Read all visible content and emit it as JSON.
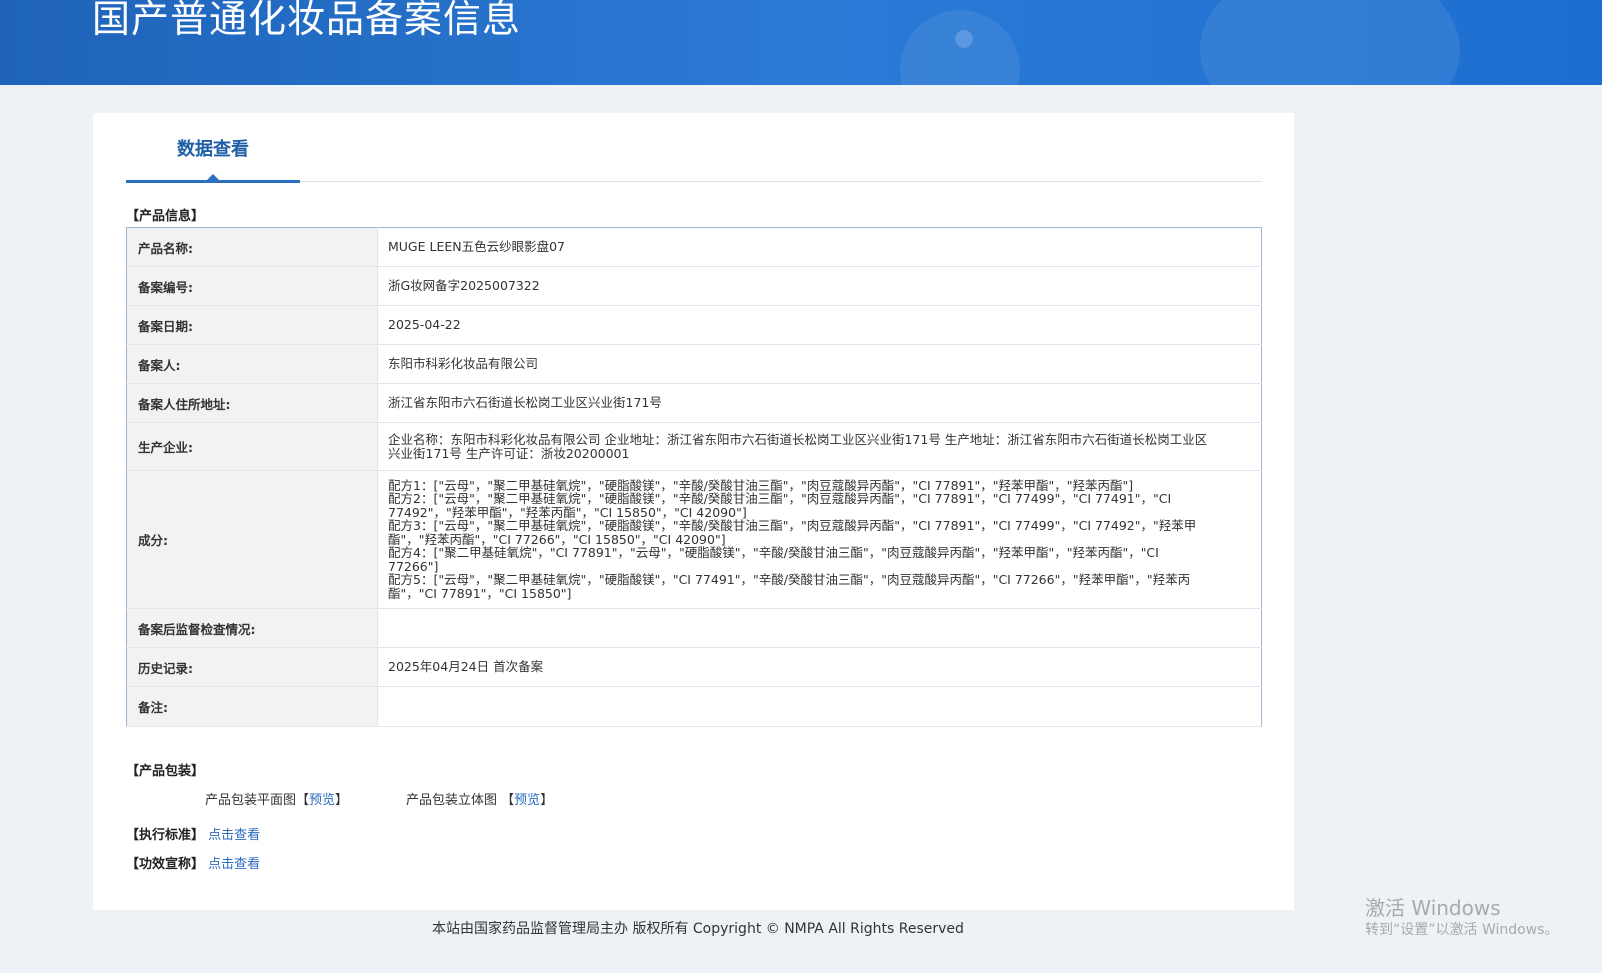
{
  "header": {
    "title": "国产普通化妆品备案信息"
  },
  "tab": {
    "label": "数据查看"
  },
  "product_info": {
    "section_label": "【产品信息】",
    "rows": [
      {
        "label": "产品名称:",
        "value": "MUGE LEEN五色云纱眼影盘07"
      },
      {
        "label": "备案编号:",
        "value": "浙G妆网备字2025007322"
      },
      {
        "label": "备案日期:",
        "value": "2025-04-22"
      },
      {
        "label": "备案人:",
        "value": "东阳市科彩化妆品有限公司"
      },
      {
        "label": "备案人住所地址:",
        "value": "浙江省东阳市六石街道长松岗工业区兴业街171号"
      },
      {
        "label": "生产企业:",
        "value": "企业名称：东阳市科彩化妆品有限公司 企业地址：浙江省东阳市六石街道长松岗工业区兴业街171号 生产地址：浙江省东阳市六石街道长松岗工业区兴业街171号 生产许可证：浙妆20200001"
      },
      {
        "label": "成分:",
        "lines": [
          "配方1：[\"云母\"，\"聚二甲基硅氧烷\"，\"硬脂酸镁\"，\"辛酸/癸酸甘油三酯\"，\"肉豆蔻酸异丙酯\"，\"CI 77891\"，\"羟苯甲酯\"，\"羟苯丙酯\"]",
          "配方2：[\"云母\"，\"聚二甲基硅氧烷\"，\"硬脂酸镁\"，\"辛酸/癸酸甘油三酯\"，\"肉豆蔻酸异丙酯\"，\"CI 77891\"，\"CI 77499\"，\"CI 77491\"，\"CI 77492\"，\"羟苯甲酯\"，\"羟苯丙酯\"，\"CI 15850\"，\"CI 42090\"]",
          "配方3：[\"云母\"，\"聚二甲基硅氧烷\"，\"硬脂酸镁\"，\"辛酸/癸酸甘油三酯\"，\"肉豆蔻酸异丙酯\"，\"CI 77891\"，\"CI 77499\"，\"CI 77492\"，\"羟苯甲酯\"，\"羟苯丙酯\"，\"CI 77266\"，\"CI 15850\"，\"CI 42090\"]",
          "配方4：[\"聚二甲基硅氧烷\"，\"CI 77891\"，\"云母\"，\"硬脂酸镁\"，\"辛酸/癸酸甘油三酯\"，\"肉豆蔻酸异丙酯\"，\"羟苯甲酯\"，\"羟苯丙酯\"，\"CI 77266\"]",
          "配方5：[\"云母\"，\"聚二甲基硅氧烷\"，\"硬脂酸镁\"，\"CI 77491\"，\"辛酸/癸酸甘油三酯\"，\"肉豆蔻酸异丙酯\"，\"CI 77266\"，\"羟苯甲酯\"，\"羟苯丙酯\"，\"CI 77891\"，\"CI 15850\"]"
        ]
      },
      {
        "label": "备案后监督检查情况:",
        "value": ""
      },
      {
        "label": "历史记录:",
        "value": "2025年04月24日 首次备案"
      },
      {
        "label": "备注:",
        "value": ""
      }
    ]
  },
  "packaging": {
    "section_label": "【产品包装】",
    "flat_label": "产品包装平面图",
    "solid_label": "产品包装立体图",
    "preview_open": "【",
    "preview_link": "预览",
    "preview_close": "】"
  },
  "standard": {
    "label": "【执行标准】",
    "link": "点击查看"
  },
  "efficacy": {
    "label": "【功效宣称】",
    "link": "点击查看"
  },
  "footer": {
    "text": "本站由国家药品监督管理局主办 版权所有 Copyright © NMPA All Rights Reserved"
  },
  "watermark": {
    "line1": "激活 Windows",
    "line2": "转到“设置”以激活 Windows。"
  }
}
